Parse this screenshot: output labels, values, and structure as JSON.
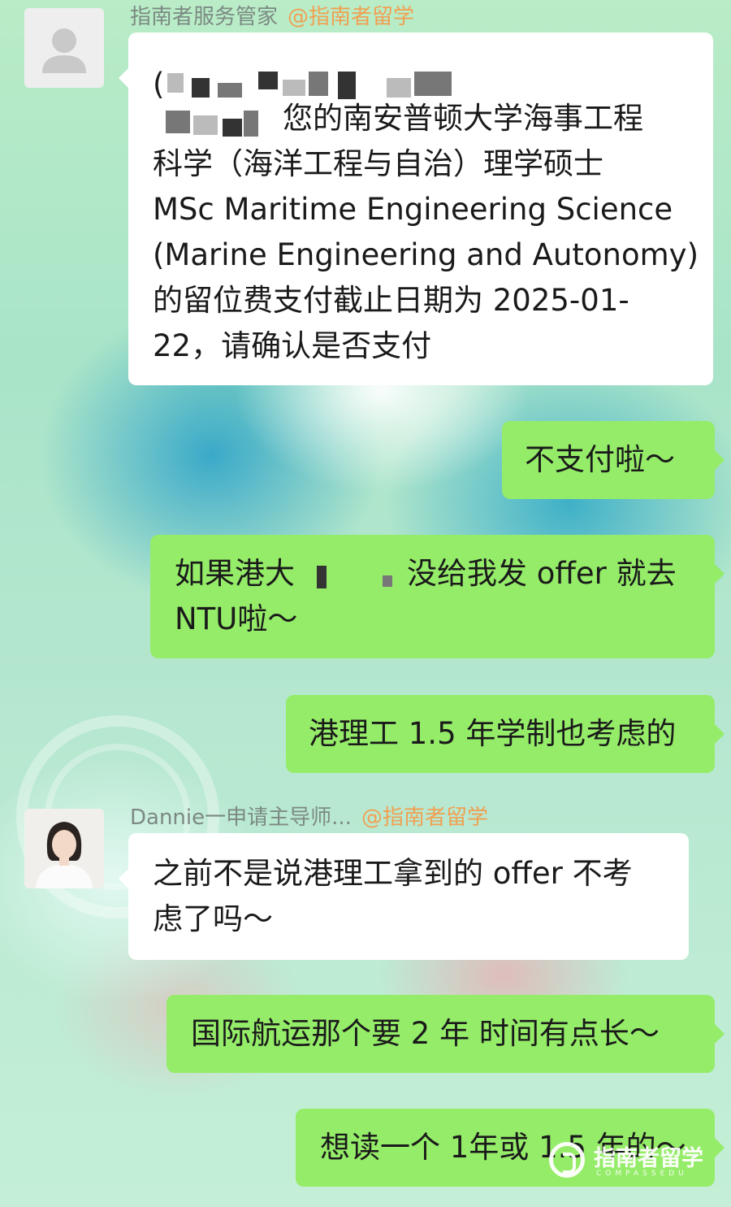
{
  "messages": [
    {
      "sender": "指南者服务管家",
      "sender_org": "@指南者留学",
      "lines": [
        "(",
        "您的南安普顿大学海事工程",
        "科学（海洋工程与自治）理学硕士",
        "MSc Maritime Engineering Science",
        "(Marine Engineering and Autonomy)",
        "的留位费支付截止日期为 2025-01-",
        "22，请确认是否支付"
      ]
    },
    {
      "text": "不支付啦～"
    },
    {
      "line1_a": "如果港大",
      "line1_b": "没给我发 offer 就去",
      "line2": "NTU啦～"
    },
    {
      "text": "港理工 1.5 年学制也考虑的"
    },
    {
      "sender": "Dannie一申请主导师...",
      "sender_org": "@指南者留学",
      "lines": [
        "之前不是说港理工拿到的 offer 不考",
        "虑了吗～"
      ]
    },
    {
      "text": "国际航运那个要 2 年 时间有点长～"
    },
    {
      "text": "想读一个 1年或 1.5 年的～"
    }
  ],
  "watermark": {
    "brand": "指南者留学",
    "sub": "COMPASSEDU"
  },
  "icons": [
    "default-avatar-icon",
    "advisor-avatar-photo",
    "compass-logo-icon"
  ]
}
